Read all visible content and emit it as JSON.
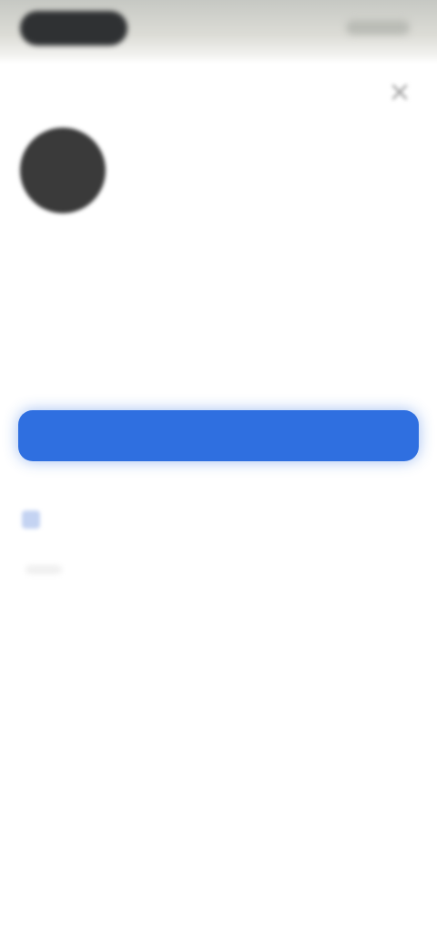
{
  "status_bar": {
    "time": "",
    "indicators": ""
  },
  "header": {
    "close_icon": "close-icon"
  },
  "profile": {
    "name": "",
    "subtitle": ""
  },
  "menu": {
    "items": [
      {
        "label": ""
      },
      {
        "label": ""
      },
      {
        "label": ""
      },
      {
        "label": ""
      }
    ]
  },
  "primary_action": {
    "label": "",
    "color": "#2F6FE0"
  },
  "consent": {
    "label": "",
    "checked": false
  },
  "colors": {
    "accent": "#2F6FE0",
    "avatar": "#3A3A3A",
    "status_bar": "#D3D5CF"
  }
}
